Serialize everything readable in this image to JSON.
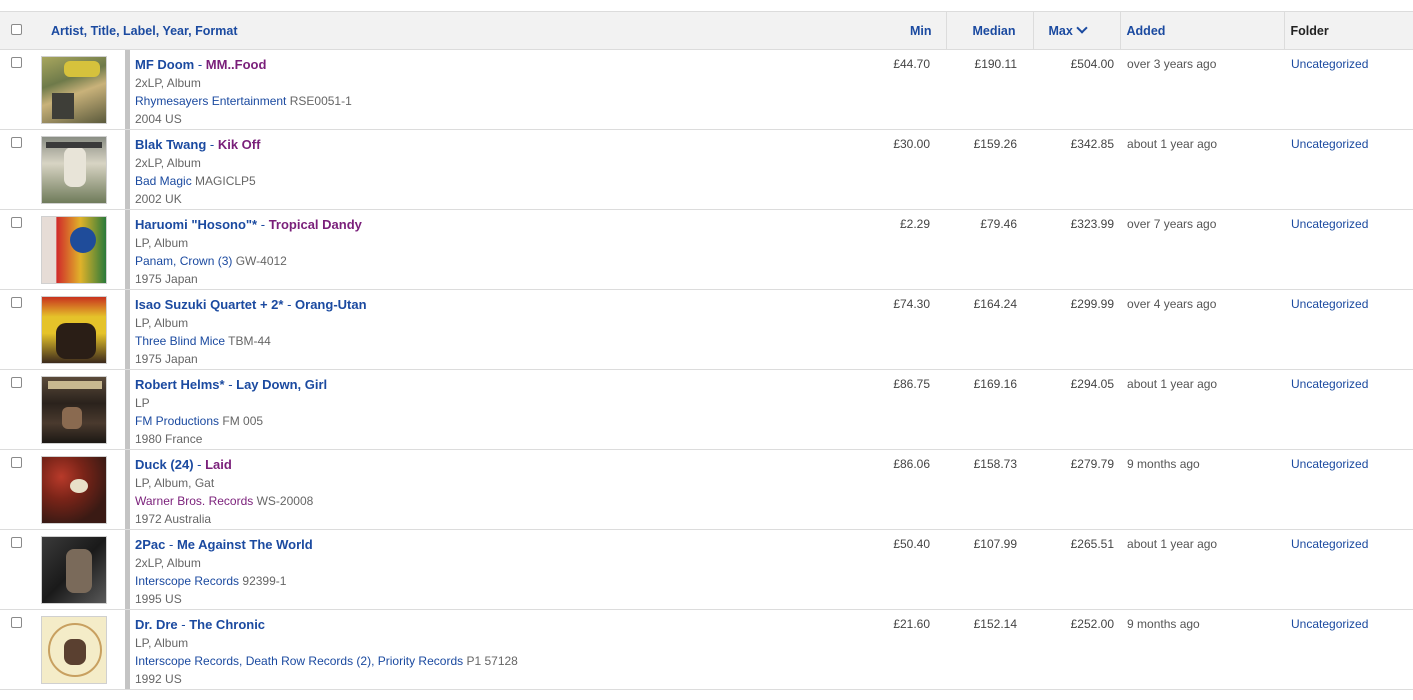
{
  "header": {
    "artist": "Artist",
    "title": "Title",
    "label": "Label",
    "year": "Year",
    "format": "Format",
    "comma": ", ",
    "min": "Min",
    "median": "Median",
    "max": "Max",
    "added": "Added",
    "folder": "Folder"
  },
  "rows": [
    {
      "artist": "MF Doom",
      "sep": " - ",
      "title": "MM..Food",
      "format": "2xLP, Album",
      "label": "Rhymesayers Entertainment",
      "catno": " RSE0051-1",
      "year_country": "2004 US",
      "min": "£44.70",
      "median": "£190.11",
      "max": "£504.00",
      "added": "over 3 years ago",
      "folder": "Uncategorized"
    },
    {
      "artist": "Blak Twang",
      "sep": " - ",
      "title": "Kik Off",
      "format": "2xLP, Album",
      "label": "Bad Magic",
      "catno": " MAGICLP5",
      "year_country": "2002 UK",
      "min": "£30.00",
      "median": "£159.26",
      "max": "£342.85",
      "added": "about 1 year ago",
      "folder": "Uncategorized"
    },
    {
      "artist": "Haruomi \"Hosono\"*",
      "sep": " - ",
      "title": "Tropical Dandy",
      "format": "LP, Album",
      "label": "Panam, Crown (3)",
      "catno": " GW-4012",
      "year_country": "1975 Japan",
      "min": "£2.29",
      "median": "£79.46",
      "max": "£323.99",
      "added": "over 7 years ago",
      "folder": "Uncategorized"
    },
    {
      "artist": "Isao Suzuki Quartet + 2*",
      "sep": " - ",
      "title": "Orang-Utan",
      "format": "LP, Album",
      "label": "Three Blind Mice",
      "catno": " TBM-44",
      "year_country": "1975 Japan",
      "min": "£74.30",
      "median": "£164.24",
      "max": "£299.99",
      "added": "over 4 years ago",
      "folder": "Uncategorized"
    },
    {
      "artist": "Robert Helms*",
      "sep": " - ",
      "title": "Lay Down, Girl",
      "format": "LP",
      "label": "FM Productions",
      "catno": " FM 005",
      "year_country": "1980 France",
      "min": "£86.75",
      "median": "£169.16",
      "max": "£294.05",
      "added": "about 1 year ago",
      "folder": "Uncategorized"
    },
    {
      "artist": "Duck (24)",
      "sep": " - ",
      "title": "Laid",
      "format": "LP, Album, Gat",
      "label": "Warner Bros. Records",
      "catno": " WS-20008",
      "year_country": "1972 Australia",
      "min": "£86.06",
      "median": "£158.73",
      "max": "£279.79",
      "added": "9 months ago",
      "folder": "Uncategorized"
    },
    {
      "artist": "2Pac",
      "sep": " - ",
      "title": "Me Against The World",
      "format": "2xLP, Album",
      "label": "Interscope Records",
      "catno": " 92399-1",
      "year_country": "1995 US",
      "min": "£50.40",
      "median": "£107.99",
      "max": "£265.51",
      "added": "about 1 year ago",
      "folder": "Uncategorized"
    },
    {
      "artist": "Dr. Dre",
      "sep": " - ",
      "title": "The Chronic",
      "format": "LP, Album",
      "label": "Interscope Records, Death Row Records (2), Priority Records",
      "catno": " P1 57128",
      "year_country": "1992 US",
      "min": "£21.60",
      "median": "£152.14",
      "max": "£252.00",
      "added": "9 months ago",
      "folder": "Uncategorized"
    }
  ],
  "style": {
    "link_blue": "#1b4aa0",
    "visited_purple": "#7a1f7a",
    "header_bg": "#f2f2f2"
  }
}
